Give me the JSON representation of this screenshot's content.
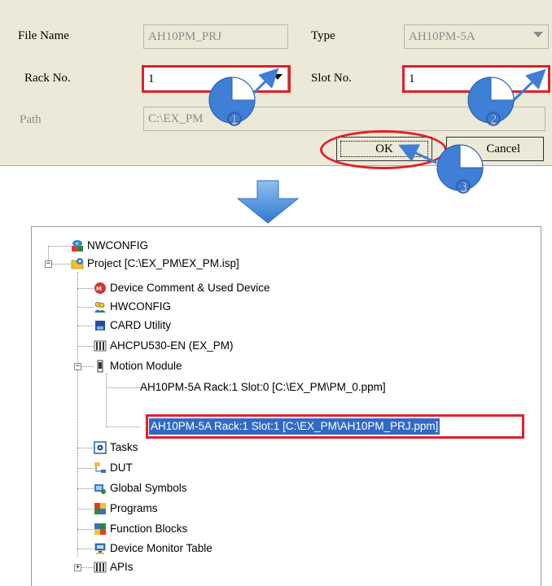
{
  "dialog": {
    "file_name_label": "File Name",
    "file_name_value": "AH10PM_PRJ",
    "type_label": "Type",
    "type_value": "AH10PM-5A",
    "rack_label": "Rack No.",
    "rack_value": "1",
    "slot_label": "Slot No.",
    "slot_value": "1",
    "path_label": "Path",
    "path_value": "C:\\EX_PM",
    "ok_label": "OK",
    "cancel_label": "Cancel"
  },
  "callouts": [
    "①",
    "②",
    "③"
  ],
  "colors": {
    "highlight": "#e0202a",
    "arrow": "#3f7fd6",
    "selection": "#316ac5",
    "dialog_bg": "#ece9d8"
  },
  "tree": {
    "nwconfig": "NWCONFIG",
    "project": "Project [C:\\EX_PM\\EX_PM.isp]",
    "device_comment": "Device Comment & Used Device",
    "hwconfig": "HWCONFIG",
    "card_utility": "CARD Utility",
    "cpu": "AHCPU530-EN  (EX_PM)",
    "motion_module": "Motion Module",
    "module_0": "AH10PM-5A Rack:1 Slot:0 [C:\\EX_PM\\PM_0.ppm]",
    "module_1": "AH10PM-5A Rack:1 Slot:1 [C:\\EX_PM\\AH10PM_PRJ.ppm]",
    "tasks": "Tasks",
    "dut": "DUT",
    "global_symbols": "Global Symbols",
    "programs": "Programs",
    "function_blocks": "Function Blocks",
    "device_monitor": "Device Monitor Table",
    "apis": "APIs"
  }
}
